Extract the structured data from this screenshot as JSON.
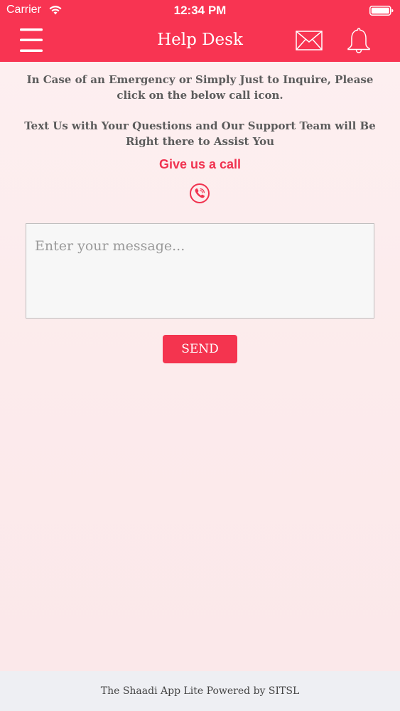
{
  "status_bar": {
    "carrier": "Carrier",
    "time": "12:34 PM"
  },
  "header": {
    "title": "Help Desk",
    "icons": {
      "menu": "hamburger-menu-icon",
      "mail": "mail-icon",
      "notifications": "bell-icon"
    }
  },
  "main": {
    "emergency_text": "In Case of an Emergency or Simply Just to Inquire, Please click on the below call icon.",
    "text_us_text": "Text Us with Your Questions and Our Support Team will Be Right there to Assist You",
    "call_label": "Give us a call",
    "call_icon": "phone-icon",
    "message_placeholder": "Enter your message...",
    "message_value": "",
    "send_label": "SEND"
  },
  "footer": {
    "text": "The Shaadi App Lite Powered by SITSL"
  },
  "colors": {
    "brand": "#f83452",
    "background": "#fdeff0",
    "footer": "#eeeff3"
  }
}
